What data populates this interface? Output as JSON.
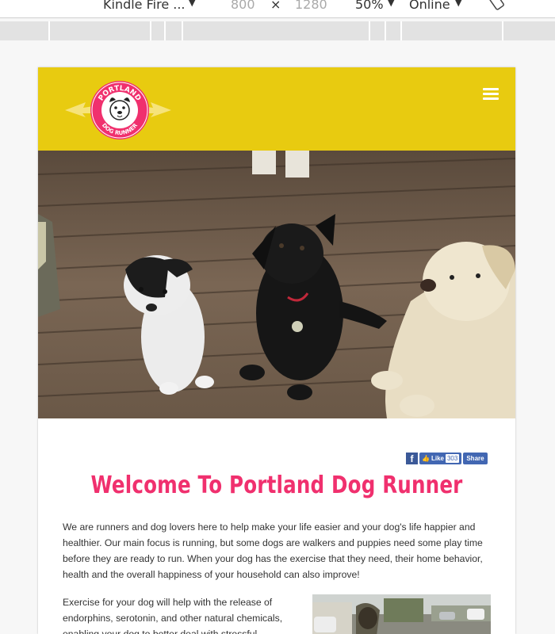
{
  "devtools": {
    "device": "Kindle Fire ...",
    "width": "800",
    "times": "×",
    "height": "1280",
    "zoom": "50%",
    "network": "Online",
    "caret": "▼"
  },
  "site": {
    "logo": {
      "top_text": "PORTLAND",
      "bottom_text": "DOG RUNNER"
    },
    "share": {
      "fb_like_label": "Like",
      "fb_like_count": "303",
      "fb_share_label": "Share"
    },
    "heading": "Welcome To Portland Dog Runner",
    "intro": "We are runners and dog lovers here to help make your life easier and your dog's life happier and healthier. Our main focus is running, but some dogs are walkers and puppies need some play time before they are ready to run.  When your dog has the exercise that they need, their home behavior, health and the overall happiness of your household can also improve!",
    "exercise": "Exercise for your dog will help with the release of endorphins, serotonin, and other natural chemicals, enabling your dog to better deal with stressful"
  },
  "colors": {
    "header_yellow": "#e8cb10",
    "brand_pink": "#f0306e",
    "facebook_blue": "#4267b2"
  }
}
